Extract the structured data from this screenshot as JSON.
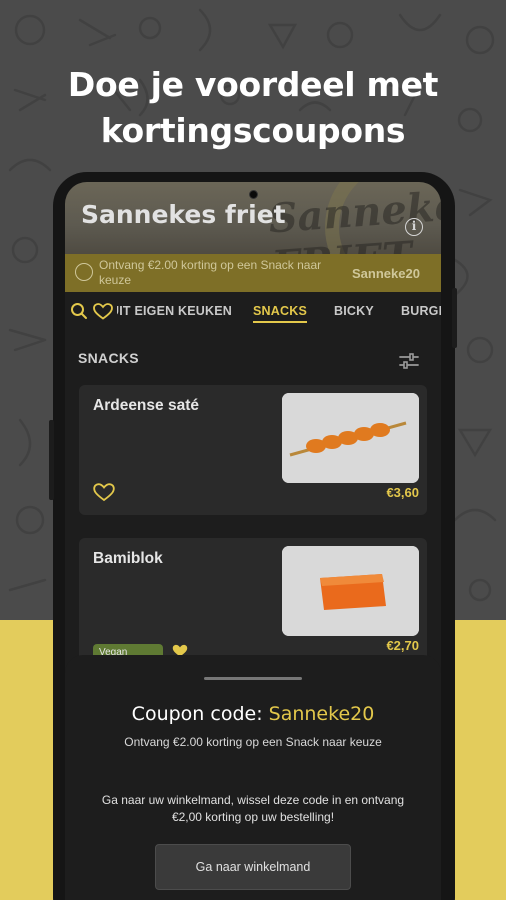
{
  "headline": {
    "line1": "Doe je voordeel met",
    "line2": "kortingscoupons"
  },
  "restaurant": {
    "name": "Sannekes friet",
    "logo_text": "Sannekes FRIET"
  },
  "promo_banner": {
    "text": "Ontvang €2.00 korting op een Snack naar keuze",
    "code": "Sanneke20"
  },
  "tabs": [
    {
      "label": "UIT EIGEN KEUKEN",
      "active": false
    },
    {
      "label": "SNACKS",
      "active": true
    },
    {
      "label": "BICKY",
      "active": false
    },
    {
      "label": "BURGERS",
      "active": false
    }
  ],
  "section": {
    "title": "SNACKS"
  },
  "products": [
    {
      "name": "Ardeense saté",
      "price": "€3,60"
    },
    {
      "name": "Bamiblok",
      "price": "€2,70",
      "badge": "Vegan"
    }
  ],
  "coupon_sheet": {
    "title_prefix": "Coupon code:",
    "code": "Sanneke20",
    "subtitle": "Ontvang €2.00 korting op een Snack naar keuze",
    "description": "Ga naar uw winkelmand, wissel deze code in en ontvang €2,00 korting op uw bestelling!",
    "button_label": "Ga naar winkelmand"
  },
  "colors": {
    "accent_yellow": "#e3c84b",
    "background_yellow": "#e3cc5c",
    "surface_dark": "#1d1d1d",
    "card_dark": "#2a2a2a"
  }
}
